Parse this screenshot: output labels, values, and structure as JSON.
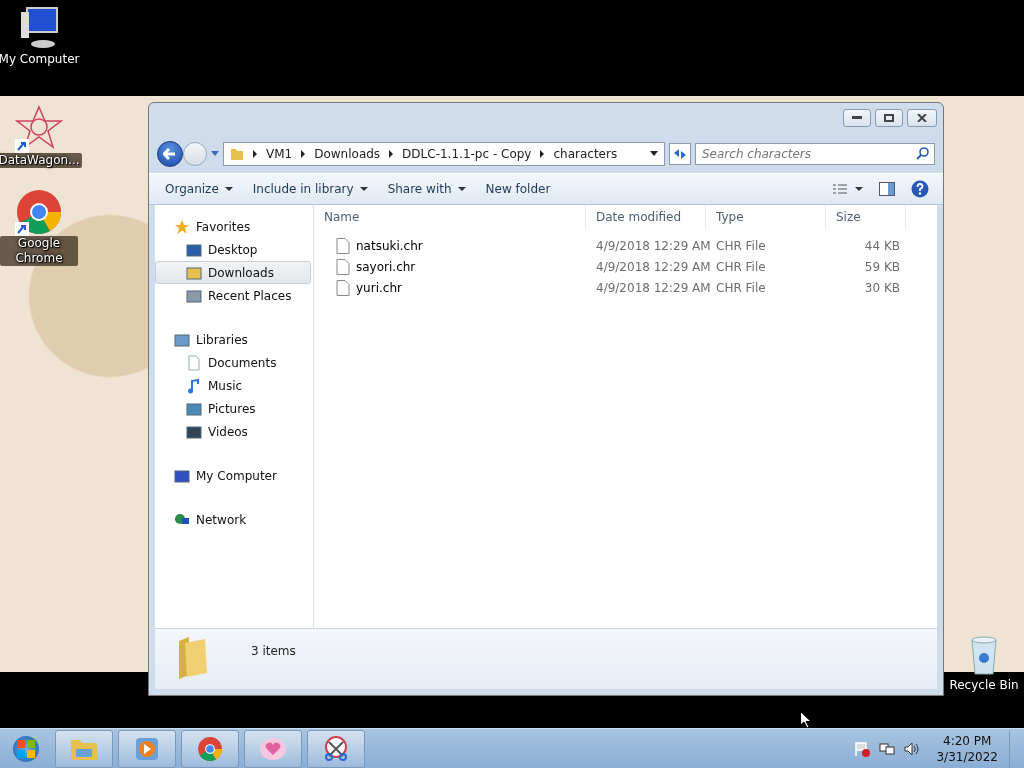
{
  "desktop_icons": [
    {
      "label": "My Computer",
      "shortcut": false
    },
    {
      "label": "DataWagon...",
      "shortcut": true
    },
    {
      "label": "Google Chrome",
      "shortcut": true
    },
    {
      "label": "Recycle Bin",
      "shortcut": false
    }
  ],
  "window": {
    "address": {
      "segments": [
        "VM1",
        "Downloads",
        "DDLC-1.1.1-pc - Copy",
        "characters"
      ]
    },
    "search": {
      "placeholder": "Search characters"
    },
    "toolbar": [
      {
        "label": "Organize",
        "dropdown": true
      },
      {
        "label": "Include in library",
        "dropdown": true
      },
      {
        "label": "Share with",
        "dropdown": true
      },
      {
        "label": "New folder",
        "dropdown": false
      }
    ],
    "navigation": [
      {
        "label": "Favorites",
        "selected": false,
        "children": [
          {
            "label": "Desktop",
            "selected": false
          },
          {
            "label": "Downloads",
            "selected": true
          },
          {
            "label": "Recent Places",
            "selected": false
          }
        ]
      },
      {
        "label": "Libraries",
        "selected": false,
        "children": [
          {
            "label": "Documents",
            "selected": false
          },
          {
            "label": "Music",
            "selected": false
          },
          {
            "label": "Pictures",
            "selected": false
          },
          {
            "label": "Videos",
            "selected": false
          }
        ]
      },
      {
        "label": "My Computer",
        "selected": false
      },
      {
        "label": "Network",
        "selected": false
      }
    ],
    "columns": [
      "Name",
      "Date modified",
      "Type",
      "Size"
    ],
    "files": [
      {
        "name": "natsuki.chr",
        "date": "4/9/2018 12:29 AM",
        "type": "CHR File",
        "size": "44 KB"
      },
      {
        "name": "sayori.chr",
        "date": "4/9/2018 12:29 AM",
        "type": "CHR File",
        "size": "59 KB"
      },
      {
        "name": "yuri.chr",
        "date": "4/9/2018 12:29 AM",
        "type": "CHR File",
        "size": "30 KB"
      }
    ],
    "status": "3 items"
  },
  "taskbar": {
    "time": "4:20 PM",
    "date": "3/31/2022"
  }
}
